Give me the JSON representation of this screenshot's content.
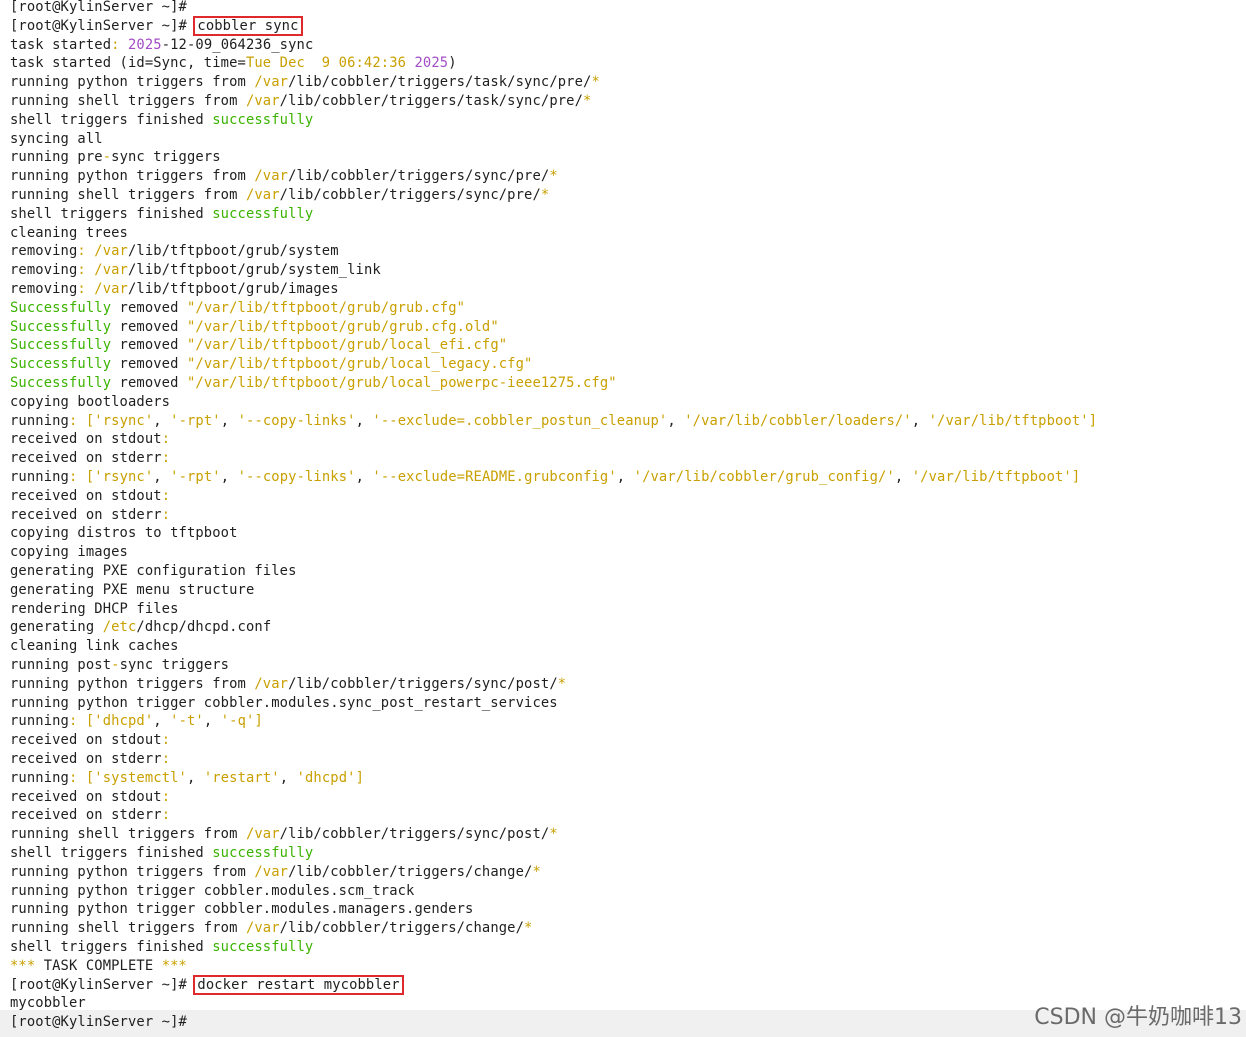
{
  "terminal": {
    "lines": [
      [
        {
          "t": "[root@KylinServer ~]#",
          "c": "k"
        }
      ],
      [
        {
          "t": "[root@KylinServer ~]# ",
          "c": "k"
        },
        {
          "t": "cobbler sync",
          "c": "k",
          "box": true
        }
      ],
      [
        {
          "t": "task started",
          "c": "k"
        },
        {
          "t": ": ",
          "c": "y"
        },
        {
          "t": "2025",
          "c": "p"
        },
        {
          "t": "-12-09_064236_sync",
          "c": "k"
        }
      ],
      [
        {
          "t": "task started (id=Sync, time=",
          "c": "k"
        },
        {
          "t": "Tue Dec  9 06:42:36 ",
          "c": "y"
        },
        {
          "t": "2025",
          "c": "p"
        },
        {
          "t": ")",
          "c": "k"
        }
      ],
      [
        {
          "t": "running python triggers from ",
          "c": "k"
        },
        {
          "t": "/var",
          "c": "y"
        },
        {
          "t": "/lib/cobbler/triggers/task/sync/pre/",
          "c": "k"
        },
        {
          "t": "*",
          "c": "y"
        }
      ],
      [
        {
          "t": "running shell triggers from ",
          "c": "k"
        },
        {
          "t": "/var",
          "c": "y"
        },
        {
          "t": "/lib/cobbler/triggers/task/sync/pre/",
          "c": "k"
        },
        {
          "t": "*",
          "c": "y"
        }
      ],
      [
        {
          "t": "shell triggers finished ",
          "c": "k"
        },
        {
          "t": "successfully",
          "c": "g"
        }
      ],
      [
        {
          "t": "syncing all",
          "c": "k"
        }
      ],
      [
        {
          "t": "running pre",
          "c": "k"
        },
        {
          "t": "-",
          "c": "y"
        },
        {
          "t": "sync triggers",
          "c": "k"
        }
      ],
      [
        {
          "t": "running python triggers from ",
          "c": "k"
        },
        {
          "t": "/var",
          "c": "y"
        },
        {
          "t": "/lib/cobbler/triggers/sync/pre/",
          "c": "k"
        },
        {
          "t": "*",
          "c": "y"
        }
      ],
      [
        {
          "t": "running shell triggers from ",
          "c": "k"
        },
        {
          "t": "/var",
          "c": "y"
        },
        {
          "t": "/lib/cobbler/triggers/sync/pre/",
          "c": "k"
        },
        {
          "t": "*",
          "c": "y"
        }
      ],
      [
        {
          "t": "shell triggers finished ",
          "c": "k"
        },
        {
          "t": "successfully",
          "c": "g"
        }
      ],
      [
        {
          "t": "cleaning trees",
          "c": "k"
        }
      ],
      [
        {
          "t": "removing",
          "c": "k"
        },
        {
          "t": ": ",
          "c": "y"
        },
        {
          "t": "/var",
          "c": "y"
        },
        {
          "t": "/lib/tftpboot/grub/system",
          "c": "k"
        }
      ],
      [
        {
          "t": "removing",
          "c": "k"
        },
        {
          "t": ": ",
          "c": "y"
        },
        {
          "t": "/var",
          "c": "y"
        },
        {
          "t": "/lib/tftpboot/grub/system_link",
          "c": "k"
        }
      ],
      [
        {
          "t": "removing",
          "c": "k"
        },
        {
          "t": ": ",
          "c": "y"
        },
        {
          "t": "/var",
          "c": "y"
        },
        {
          "t": "/lib/tftpboot/grub/images",
          "c": "k"
        }
      ],
      [
        {
          "t": "Successfully",
          "c": "g"
        },
        {
          "t": " removed ",
          "c": "k"
        },
        {
          "t": "\"/var/lib/tftpboot/grub/grub.cfg\"",
          "c": "y"
        }
      ],
      [
        {
          "t": "Successfully",
          "c": "g"
        },
        {
          "t": " removed ",
          "c": "k"
        },
        {
          "t": "\"/var/lib/tftpboot/grub/grub.cfg.old\"",
          "c": "y"
        }
      ],
      [
        {
          "t": "Successfully",
          "c": "g"
        },
        {
          "t": " removed ",
          "c": "k"
        },
        {
          "t": "\"/var/lib/tftpboot/grub/local_efi.cfg\"",
          "c": "y"
        }
      ],
      [
        {
          "t": "Successfully",
          "c": "g"
        },
        {
          "t": " removed ",
          "c": "k"
        },
        {
          "t": "\"/var/lib/tftpboot/grub/local_legacy.cfg\"",
          "c": "y"
        }
      ],
      [
        {
          "t": "Successfully",
          "c": "g"
        },
        {
          "t": " removed ",
          "c": "k"
        },
        {
          "t": "\"/var/lib/tftpboot/grub/local_powerpc-ieee1275.cfg\"",
          "c": "y"
        }
      ],
      [
        {
          "t": "copying bootloaders",
          "c": "k"
        }
      ],
      [
        {
          "t": "running",
          "c": "k"
        },
        {
          "t": ": ",
          "c": "y"
        },
        {
          "t": "[",
          "c": "y"
        },
        {
          "t": "'rsync'",
          "c": "y"
        },
        {
          "t": ", ",
          "c": "k"
        },
        {
          "t": "'-rpt'",
          "c": "y"
        },
        {
          "t": ", ",
          "c": "k"
        },
        {
          "t": "'--copy-links'",
          "c": "y"
        },
        {
          "t": ", ",
          "c": "k"
        },
        {
          "t": "'--exclude=.cobbler_postun_cleanup'",
          "c": "y"
        },
        {
          "t": ", ",
          "c": "k"
        },
        {
          "t": "'/var/lib/cobbler/loaders/'",
          "c": "y"
        },
        {
          "t": ", ",
          "c": "k"
        },
        {
          "t": "'/var/lib/tftpboot'",
          "c": "y"
        },
        {
          "t": "]",
          "c": "y"
        }
      ],
      [
        {
          "t": "received on stdout",
          "c": "k"
        },
        {
          "t": ":",
          "c": "y"
        }
      ],
      [
        {
          "t": "received on stderr",
          "c": "k"
        },
        {
          "t": ":",
          "c": "y"
        }
      ],
      [
        {
          "t": "running",
          "c": "k"
        },
        {
          "t": ": ",
          "c": "y"
        },
        {
          "t": "[",
          "c": "y"
        },
        {
          "t": "'rsync'",
          "c": "y"
        },
        {
          "t": ", ",
          "c": "k"
        },
        {
          "t": "'-rpt'",
          "c": "y"
        },
        {
          "t": ", ",
          "c": "k"
        },
        {
          "t": "'--copy-links'",
          "c": "y"
        },
        {
          "t": ", ",
          "c": "k"
        },
        {
          "t": "'--exclude=README.grubconfig'",
          "c": "y"
        },
        {
          "t": ", ",
          "c": "k"
        },
        {
          "t": "'/var/lib/cobbler/grub_config/'",
          "c": "y"
        },
        {
          "t": ", ",
          "c": "k"
        },
        {
          "t": "'/var/lib/tftpboot'",
          "c": "y"
        },
        {
          "t": "]",
          "c": "y"
        }
      ],
      [
        {
          "t": "received on stdout",
          "c": "k"
        },
        {
          "t": ":",
          "c": "y"
        }
      ],
      [
        {
          "t": "received on stderr",
          "c": "k"
        },
        {
          "t": ":",
          "c": "y"
        }
      ],
      [
        {
          "t": "copying distros to tftpboot",
          "c": "k"
        }
      ],
      [
        {
          "t": "copying images",
          "c": "k"
        }
      ],
      [
        {
          "t": "generating PXE configuration files",
          "c": "k"
        }
      ],
      [
        {
          "t": "generating PXE menu structure",
          "c": "k"
        }
      ],
      [
        {
          "t": "rendering DHCP files",
          "c": "k"
        }
      ],
      [
        {
          "t": "generating ",
          "c": "k"
        },
        {
          "t": "/etc",
          "c": "y"
        },
        {
          "t": "/dhcp/dhcpd.conf",
          "c": "k"
        }
      ],
      [
        {
          "t": "cleaning link caches",
          "c": "k"
        }
      ],
      [
        {
          "t": "running post",
          "c": "k"
        },
        {
          "t": "-",
          "c": "y"
        },
        {
          "t": "sync triggers",
          "c": "k"
        }
      ],
      [
        {
          "t": "running python triggers from ",
          "c": "k"
        },
        {
          "t": "/var",
          "c": "y"
        },
        {
          "t": "/lib/cobbler/triggers/sync/post/",
          "c": "k"
        },
        {
          "t": "*",
          "c": "y"
        }
      ],
      [
        {
          "t": "running python trigger cobbler.modules.sync_post_restart_services",
          "c": "k"
        }
      ],
      [
        {
          "t": "running",
          "c": "k"
        },
        {
          "t": ": ",
          "c": "y"
        },
        {
          "t": "[",
          "c": "y"
        },
        {
          "t": "'dhcpd'",
          "c": "y"
        },
        {
          "t": ", ",
          "c": "k"
        },
        {
          "t": "'-t'",
          "c": "y"
        },
        {
          "t": ", ",
          "c": "k"
        },
        {
          "t": "'-q'",
          "c": "y"
        },
        {
          "t": "]",
          "c": "y"
        }
      ],
      [
        {
          "t": "received on stdout",
          "c": "k"
        },
        {
          "t": ":",
          "c": "y"
        }
      ],
      [
        {
          "t": "received on stderr",
          "c": "k"
        },
        {
          "t": ":",
          "c": "y"
        }
      ],
      [
        {
          "t": "running",
          "c": "k"
        },
        {
          "t": ": ",
          "c": "y"
        },
        {
          "t": "[",
          "c": "y"
        },
        {
          "t": "'systemctl'",
          "c": "y"
        },
        {
          "t": ", ",
          "c": "k"
        },
        {
          "t": "'restart'",
          "c": "y"
        },
        {
          "t": ", ",
          "c": "k"
        },
        {
          "t": "'dhcpd'",
          "c": "y"
        },
        {
          "t": "]",
          "c": "y"
        }
      ],
      [
        {
          "t": "received on stdout",
          "c": "k"
        },
        {
          "t": ":",
          "c": "y"
        }
      ],
      [
        {
          "t": "received on stderr",
          "c": "k"
        },
        {
          "t": ":",
          "c": "y"
        }
      ],
      [
        {
          "t": "running shell triggers from ",
          "c": "k"
        },
        {
          "t": "/var",
          "c": "y"
        },
        {
          "t": "/lib/cobbler/triggers/sync/post/",
          "c": "k"
        },
        {
          "t": "*",
          "c": "y"
        }
      ],
      [
        {
          "t": "shell triggers finished ",
          "c": "k"
        },
        {
          "t": "successfully",
          "c": "g"
        }
      ],
      [
        {
          "t": "running python triggers from ",
          "c": "k"
        },
        {
          "t": "/var",
          "c": "y"
        },
        {
          "t": "/lib/cobbler/triggers/change/",
          "c": "k"
        },
        {
          "t": "*",
          "c": "y"
        }
      ],
      [
        {
          "t": "running python trigger cobbler.modules.scm_track",
          "c": "k"
        }
      ],
      [
        {
          "t": "running python trigger cobbler.modules.managers.genders",
          "c": "k"
        }
      ],
      [
        {
          "t": "running shell triggers from ",
          "c": "k"
        },
        {
          "t": "/var",
          "c": "y"
        },
        {
          "t": "/lib/cobbler/triggers/change/",
          "c": "k"
        },
        {
          "t": "*",
          "c": "y"
        }
      ],
      [
        {
          "t": "shell triggers finished ",
          "c": "k"
        },
        {
          "t": "successfully",
          "c": "g"
        }
      ],
      [
        {
          "t": "***",
          "c": "y"
        },
        {
          "t": " TASK COMPLETE ",
          "c": "k"
        },
        {
          "t": "***",
          "c": "y"
        }
      ],
      [
        {
          "t": "[root@KylinServer ~]# ",
          "c": "k"
        },
        {
          "t": "docker restart mycobbler",
          "c": "k",
          "box": true
        }
      ],
      [
        {
          "t": "mycobbler",
          "c": "k"
        }
      ],
      [
        {
          "t": "[root@KylinServer ~]# ",
          "c": "k"
        }
      ]
    ]
  },
  "watermark": {
    "text": "CSDN @牛奶咖啡13"
  },
  "colors": {
    "default": "#1f1f1f",
    "path": "#c9a000",
    "success": "#3bb300",
    "number": "#a24ec6",
    "highlight_box": "#e0292c"
  }
}
